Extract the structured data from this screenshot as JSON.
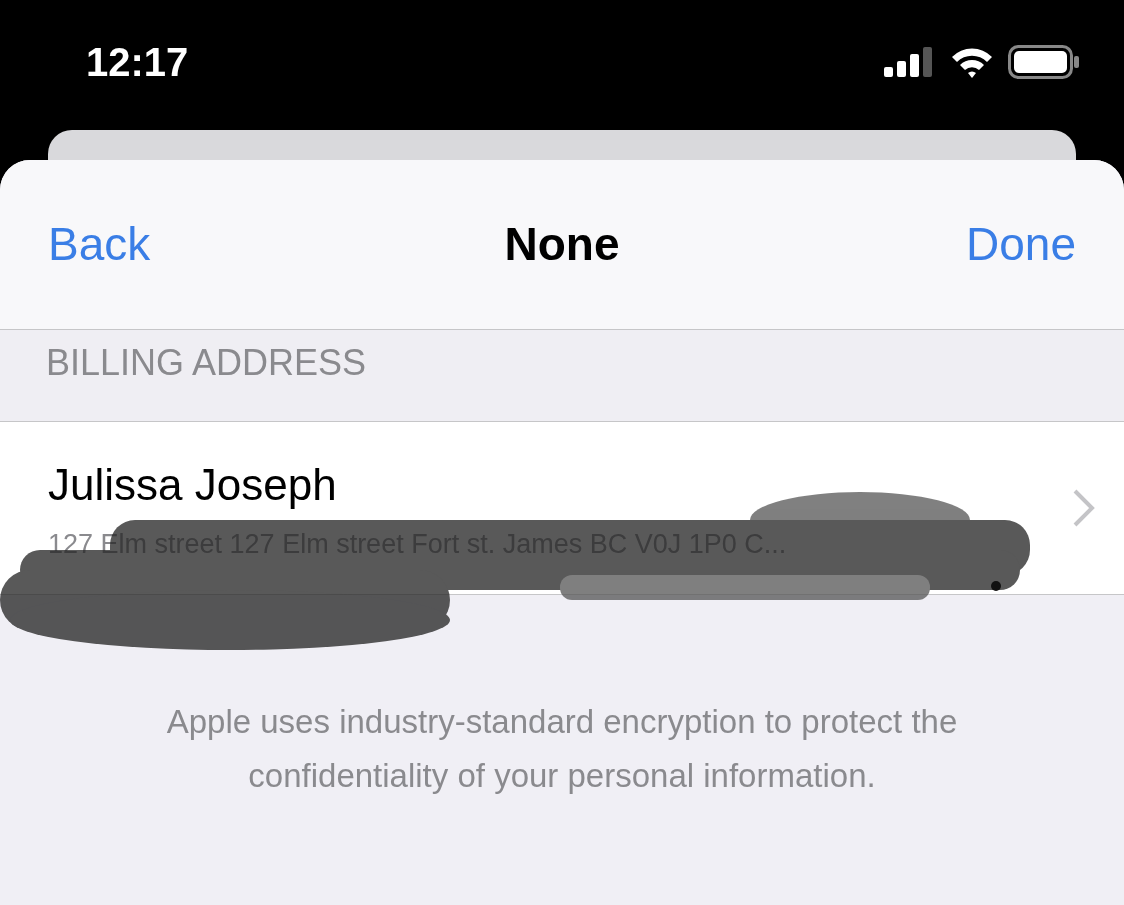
{
  "status_bar": {
    "time": "12:17"
  },
  "nav": {
    "back": "Back",
    "title": "None",
    "done": "Done"
  },
  "section": {
    "header": "BILLING ADDRESS",
    "rows": [
      {
        "name": "Julissa Joseph",
        "address": "127 Elm street 127 Elm street Fort st. James BC V0J 1P0 C..."
      }
    ]
  },
  "footer": "Apple uses industry-standard encryption to protect the confidentiality of your personal information."
}
